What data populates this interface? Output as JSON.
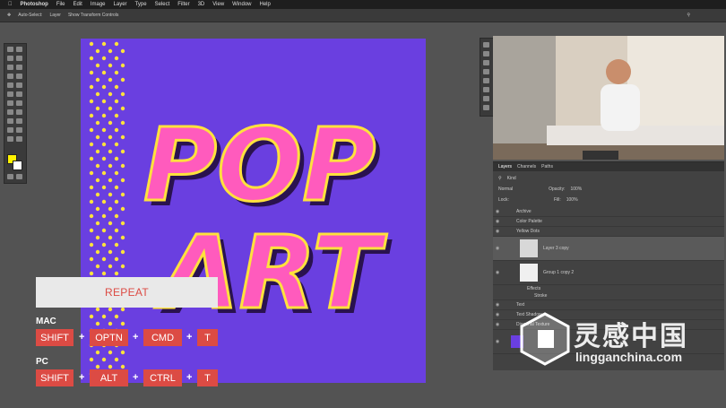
{
  "menubar": {
    "app": "Photoshop",
    "items": [
      "File",
      "Edit",
      "Image",
      "Layer",
      "Type",
      "Select",
      "Filter",
      "3D",
      "View",
      "Window",
      "Help"
    ]
  },
  "options_bar": {
    "auto_select": "Auto-Select:",
    "auto_select_value": "Layer",
    "show_transform": "Show Transform Controls"
  },
  "layers_panel": {
    "tabs": [
      "Layers",
      "Channels",
      "Paths"
    ],
    "filter": "Kind",
    "blend_mode": "Normal",
    "opacity_label": "Opacity:",
    "opacity": "100%",
    "lock_label": "Lock:",
    "fill_label": "Fill:",
    "fill": "100%",
    "layers": [
      {
        "name": "Archive"
      },
      {
        "name": "Color Palette"
      },
      {
        "name": "Yellow Dots"
      },
      {
        "name": "Layer 3 copy"
      },
      {
        "name": "Group 1 copy 2"
      },
      {
        "name": "Effects"
      },
      {
        "name": "Stroke"
      },
      {
        "name": "Text"
      },
      {
        "name": "Text Shadow"
      },
      {
        "name": "Diagonal Texture"
      }
    ]
  },
  "artwork": {
    "line1": "POP",
    "line2": "ART"
  },
  "overlay": {
    "repeat": "REPEAT",
    "mac_label": "MAC",
    "pc_label": "PC",
    "mac_keys": [
      "SHIFT",
      "OPTN",
      "CMD",
      "T"
    ],
    "pc_keys": [
      "SHIFT",
      "ALT",
      "CTRL",
      "T"
    ],
    "plus": "+"
  },
  "watermark": {
    "cn": "灵感中国",
    "url": "lingganchina.com"
  },
  "colors": {
    "canvas": "#6a3fe0",
    "pink": "#ff5bbd",
    "yellow": "#ffe23c",
    "key_red": "#dc4b44"
  }
}
